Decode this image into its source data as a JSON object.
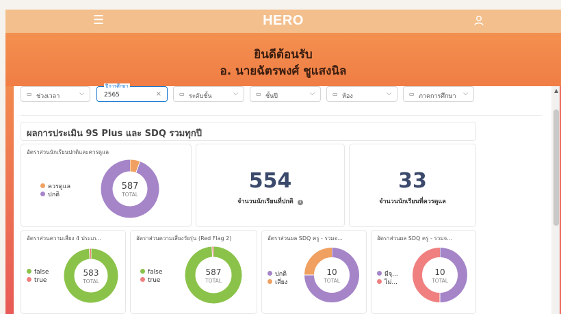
{
  "header": {
    "brand": "HERO"
  },
  "hero": {
    "line1": "ยินดีต้อนรับ",
    "line2": "อ. นายฉัตรพงศ์ ชูแสงนิล"
  },
  "filters": [
    {
      "label": "ช่วงเวลา"
    },
    {
      "floating_label": "ปีการศึกษา",
      "value": "2565"
    },
    {
      "label": "ระดับชั้น"
    },
    {
      "label": "ชั้นปี"
    },
    {
      "label": "ห้อง"
    },
    {
      "label": "ภาคการศึกษา"
    }
  ],
  "section": {
    "title": "ผลการประเมิน 9S Plus และ SDQ รวมทุกปี"
  },
  "summary_card": {
    "title": "อัตราส่วนนักเรียนปกติและควรดูแล",
    "legend": [
      "ควรดูแล",
      "ปกติ"
    ],
    "total": "587",
    "total_label": "TOTAL",
    "segments": [
      {
        "name": "ควรดูแล",
        "value": 33,
        "color": "#f0a060"
      },
      {
        "name": "ปกติ",
        "value": 554,
        "color": "#a585c8"
      }
    ]
  },
  "stat_normal": {
    "value": "554",
    "label": "จำนวนนักเรียนที่ปกติ"
  },
  "stat_care": {
    "value": "33",
    "label": "จำนวนนักเรียนที่ควรดูแล"
  },
  "donuts": [
    {
      "title": "อัตราส่วนความเสี่ยง 4 ประเภ...",
      "legend": [
        "false",
        "true"
      ],
      "total": "583",
      "total_label": "TOTAL",
      "segments": [
        {
          "name": "false",
          "value": 577,
          "color": "#8bc34a"
        },
        {
          "name": "true",
          "value": 6,
          "color": "#f08080"
        }
      ]
    },
    {
      "title": "อัตราส่วนความเสี่ยงวัยรุ่น (Red Flag 2)",
      "legend": [
        "false",
        "true"
      ],
      "total": "587",
      "total_label": "TOTAL",
      "segments": [
        {
          "name": "false",
          "value": 582,
          "color": "#8bc34a"
        },
        {
          "name": "true",
          "value": 5,
          "color": "#f08080"
        }
      ]
    },
    {
      "title": "อัตราส่วนผล SDQ ครู - รวมจ...",
      "legend": [
        "ปกติ",
        "เสี่ยง"
      ],
      "total": "10",
      "total_label": "TOTAL",
      "segments": [
        {
          "name": "ปกติ",
          "value": 7.5,
          "color": "#a585c8"
        },
        {
          "name": "เสี่ยง",
          "value": 2.5,
          "color": "#f0a060"
        }
      ]
    },
    {
      "title": "อัตราส่วนผล SDQ ครู - รวมจ...",
      "legend": [
        "มีจุ...",
        "ไม่..."
      ],
      "total": "10",
      "total_label": "TOTAL",
      "segments": [
        {
          "name": "มีจุ...",
          "value": 5,
          "color": "#a585c8"
        },
        {
          "name": "ไม่...",
          "value": 5,
          "color": "#f08080"
        }
      ]
    }
  ],
  "colors": {
    "accent": "#1976d2",
    "header": "#f3bf8c",
    "hero": "#f07d45",
    "stat_number": "#3b4a6b"
  }
}
